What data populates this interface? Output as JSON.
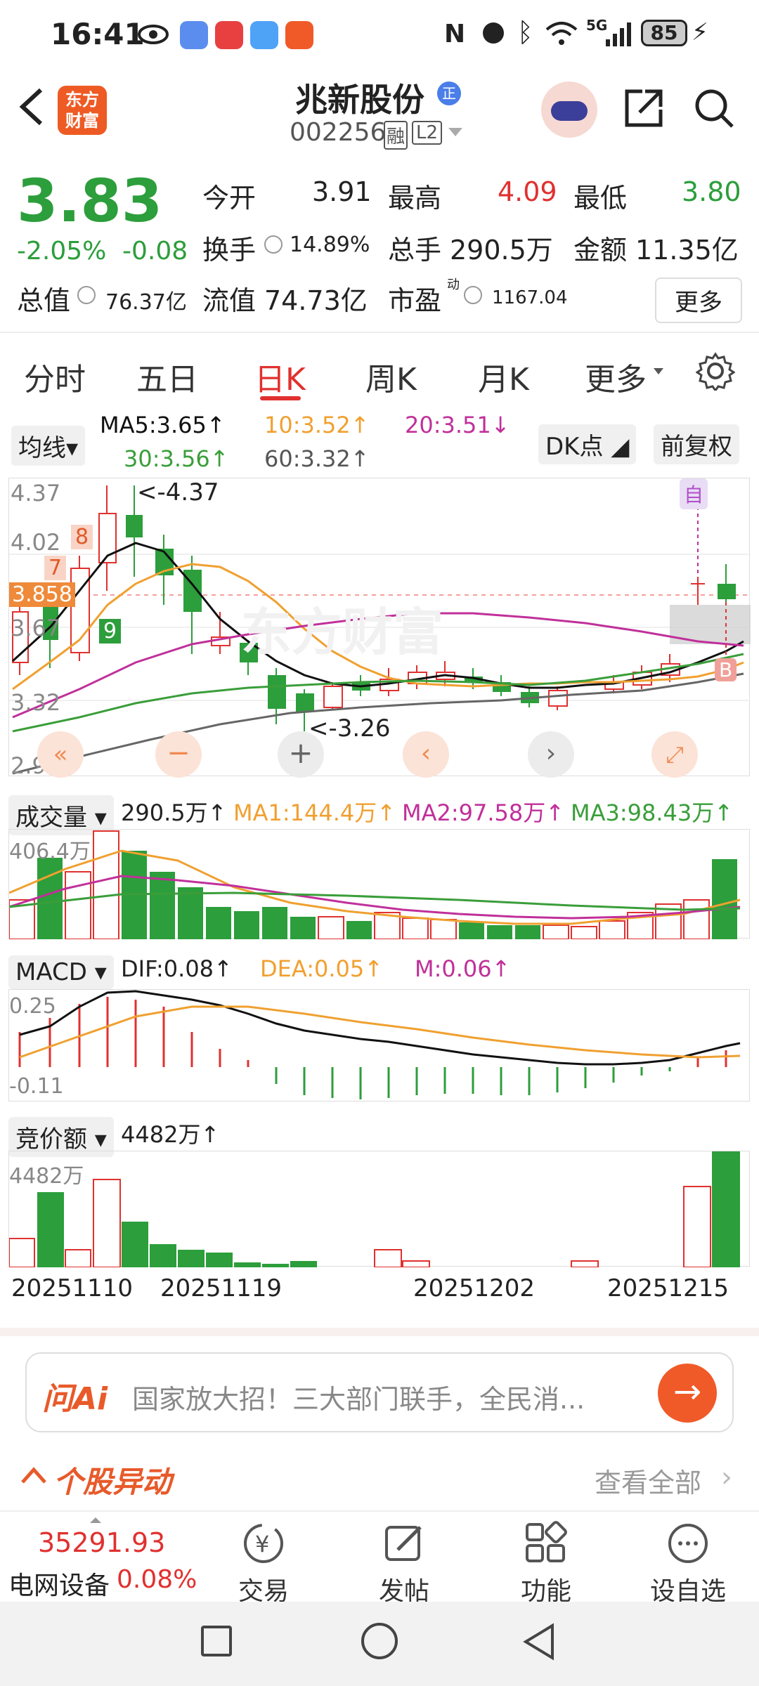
{
  "status_bar": {
    "time": "16:41",
    "network": "5G",
    "battery": "85"
  },
  "header": {
    "logo_text": "东方财富",
    "stock_name": "兆新股份",
    "badge": "正",
    "code": "002256",
    "tag_margin": "融",
    "tag_level": "L2"
  },
  "quote": {
    "price": "3.83",
    "change_pct": "-2.05%",
    "change": "-0.08",
    "open_label": "今开",
    "open": "3.91",
    "high_label": "最高",
    "high": "4.09",
    "low_label": "最低",
    "low": "3.80",
    "turnover_label": "换手",
    "turnover": "14.89%",
    "volume_label": "总手",
    "volume": "290.5万",
    "amount_label": "金额",
    "amount": "11.35亿",
    "mktcap_label": "总值",
    "mktcap": "76.37亿",
    "float_label": "流值",
    "float": "74.73亿",
    "pe_label": "市盈",
    "pe_sup": "动",
    "pe": "1167.04",
    "more": "更多"
  },
  "tabs": [
    "分时",
    "五日",
    "日K",
    "周K",
    "月K",
    "更多"
  ],
  "active_tab": 2,
  "ma_bar": {
    "selector": "均线",
    "ma5": "MA5:3.65↑",
    "ma10": "10:3.52↑",
    "ma20": "20:3.51↓",
    "ma30": "30:3.56↑",
    "ma60": "60:3.32↑",
    "dk": "DK点",
    "adjust": "前复权"
  },
  "kline": {
    "y_labels": [
      "4.37",
      "4.02",
      "3.67",
      "3.32",
      "2.97"
    ],
    "current_price_tag": "3.858",
    "high_marker": "<-4.37",
    "low_marker": "<-3.26",
    "tag_8": "8",
    "tag_7": "7",
    "tag_9": "9",
    "tag_self": "自",
    "tag_buy": "B",
    "watermark": "东方财富"
  },
  "volume_bar": {
    "selector": "成交量",
    "value": "290.5万↑",
    "ma1": "MA1:144.4万↑",
    "ma2": "MA2:97.58万↑",
    "ma3": "MA3:98.43万↑",
    "y_top": "406.4万"
  },
  "macd_bar": {
    "selector": "MACD",
    "dif": "DIF:0.08↑",
    "dea": "DEA:0.05↑",
    "m": "M:0.06↑",
    "y_top": "0.25",
    "y_bottom": "-0.11"
  },
  "auction_bar": {
    "selector": "竞价额",
    "value": "4482万↑",
    "y_top": "4482万"
  },
  "dates": [
    "20251110",
    "20251119",
    "20251202",
    "20251215"
  ],
  "ai": {
    "logo": "问Ai",
    "text": "国家放大招！三大部门联手，全民消..."
  },
  "movement": {
    "title": "个股异动",
    "link": "查看全部"
  },
  "bottom_nav": {
    "index_value": "35291.93",
    "index_name": "电网设备",
    "index_change": "0.08%",
    "items": [
      "交易",
      "发帖",
      "功能",
      "设自选"
    ]
  },
  "colors": {
    "up": "#e0312f",
    "down": "#2c9e3b",
    "ma5": "#111111",
    "ma10": "#f0a030",
    "ma20": "#c0309a",
    "ma30": "#3a9e3a",
    "ma60": "#555555"
  }
}
